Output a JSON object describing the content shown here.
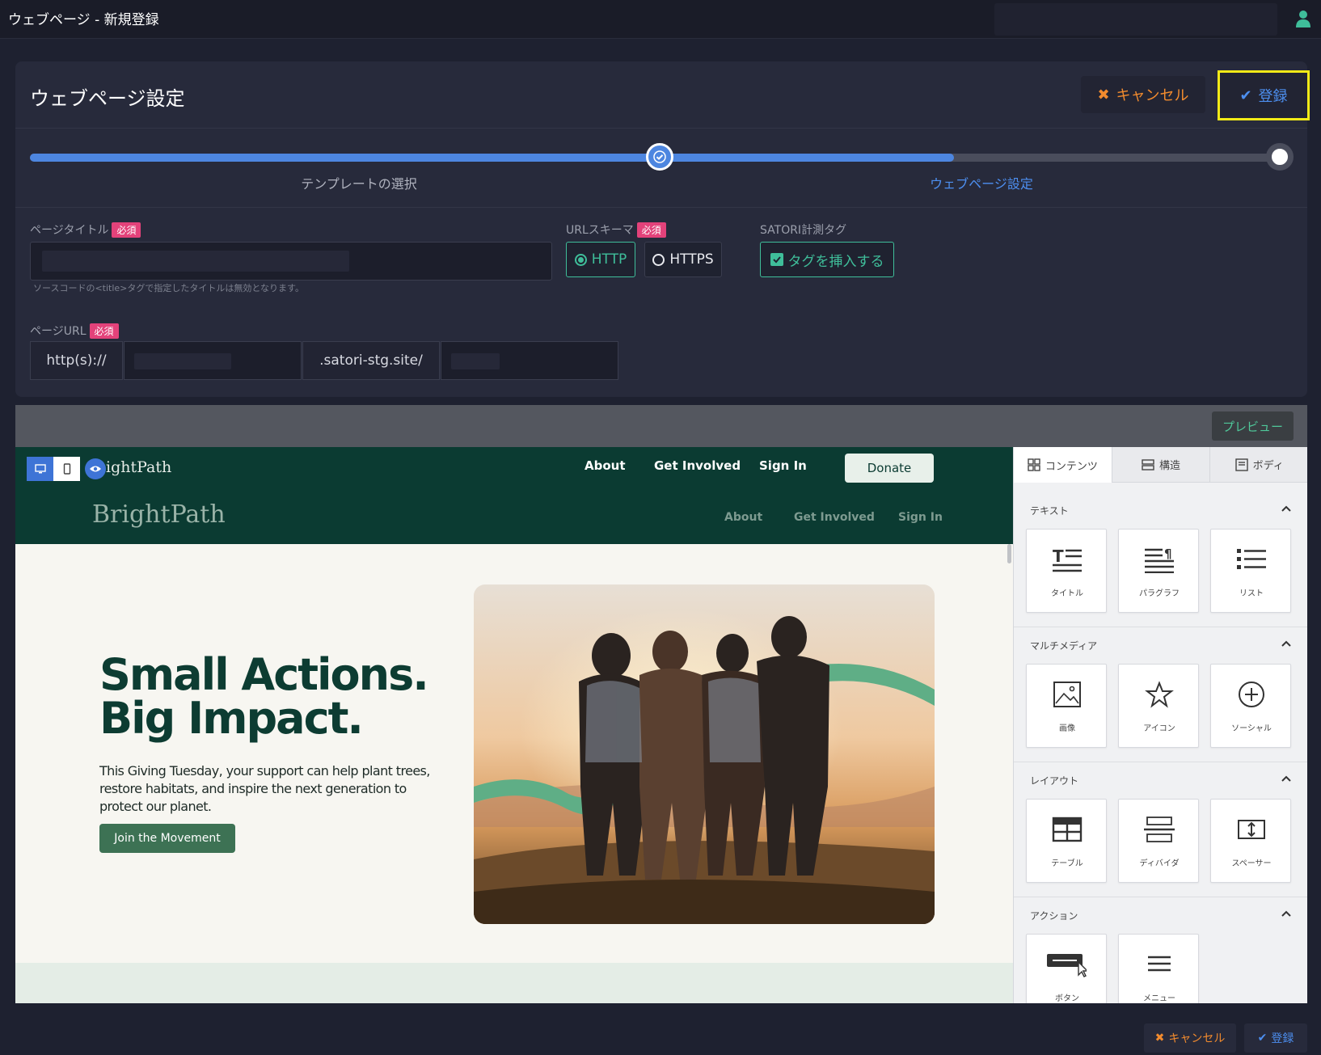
{
  "window": {
    "title": "ウェブページ - 新規登録"
  },
  "header": {
    "title": "ウェブページ設定",
    "cancel_label": "キャンセル",
    "save_label": "登録"
  },
  "progress": {
    "steps": [
      "テンプレートの選択",
      "ウェブページ設定"
    ],
    "fill_fraction": 0.74
  },
  "form": {
    "required_badge": "必須",
    "page_title": {
      "label": "ページタイトル",
      "hint": "ソースコードの<title>タグで指定したタイトルは無効となります。"
    },
    "url_scheme": {
      "label": "URLスキーマ",
      "options": [
        "HTTP",
        "HTTPS"
      ],
      "selected": "HTTP"
    },
    "satori_tag": {
      "label": "SATORI計測タグ",
      "checkbox_label": "タグを挿入する",
      "checked": true
    },
    "page_url": {
      "label": "ページURL",
      "prefix": "http(s)://",
      "domain": ".satori-stg.site/"
    }
  },
  "editor": {
    "preview_label": "プレビュー",
    "site": {
      "logo": "BrightPath",
      "logo_top": "ightPath",
      "nav": [
        "About",
        "Get Involved",
        "Sign In"
      ],
      "donate": "Donate",
      "hero_line1": "Small Actions.",
      "hero_line2": "Big Impact.",
      "hero_text": "This Giving Tuesday, your support can help plant trees, restore habitats, and inspire the next generation to protect our planet.",
      "hero_button": "Join the Movement"
    },
    "panel": {
      "tabs": [
        "コンテンツ",
        "構造",
        "ボディ"
      ],
      "sections": [
        {
          "title": "テキスト",
          "items": [
            "タイトル",
            "パラグラフ",
            "リスト"
          ]
        },
        {
          "title": "マルチメディア",
          "items": [
            "画像",
            "アイコン",
            "ソーシャル"
          ]
        },
        {
          "title": "レイアウト",
          "items": [
            "テーブル",
            "ディバイダ",
            "スペーサー"
          ]
        },
        {
          "title": "アクション",
          "items": [
            "ボタン",
            "メニュー"
          ]
        }
      ]
    }
  },
  "footer": {
    "cancel_label": "キャンセル",
    "save_label": "登録"
  },
  "colors": {
    "accent_blue": "#4d86e0",
    "accent_green": "#3fbe9a",
    "cancel_orange": "#f28b2e",
    "required_pink": "#e3427a",
    "highlight_yellow": "#f2ea17",
    "site_dark_green": "#0b3b32"
  }
}
